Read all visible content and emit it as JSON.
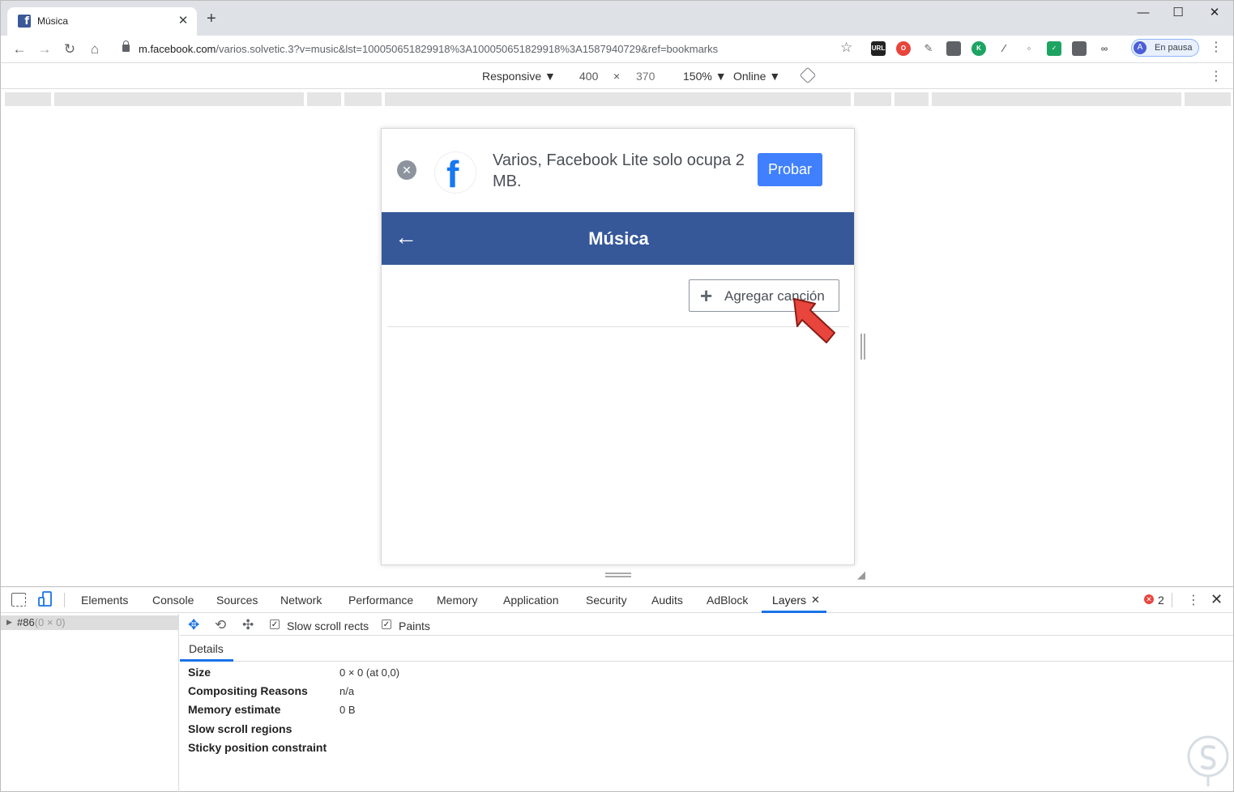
{
  "browser": {
    "tab_title": "Música",
    "tab_favicon": "facebook-f",
    "url_host": "m.facebook.com",
    "url_path": "/varios.solvetic.3?v=music&lst=100050651829918%3A100050651829918%3A1587940729&ref=bookmarks",
    "profile_initial": "A",
    "profile_label": "En pausa"
  },
  "device_toolbar": {
    "device": "Responsive",
    "width": "400",
    "times": "×",
    "height": "370",
    "zoom": "150%",
    "network": "Online"
  },
  "page": {
    "banner_text": "Varios, Facebook Lite solo ocupa 2 MB.",
    "banner_button": "Probar",
    "header_title": "Música",
    "add_button": "Agregar canción"
  },
  "devtools": {
    "tabs": [
      "Elements",
      "Console",
      "Sources",
      "Network",
      "Performance",
      "Memory",
      "Application",
      "Security",
      "Audits",
      "AdBlock",
      "Layers"
    ],
    "active_tab": "Layers",
    "error_count": "2",
    "layer_node": "#86",
    "layer_node_dims": "(0 × 0)",
    "slow_scroll_rects": "Slow scroll rects",
    "paints": "Paints",
    "details_tab": "Details",
    "properties": [
      {
        "name": "Size",
        "value": "0 × 0 (at 0,0)"
      },
      {
        "name": "Compositing Reasons",
        "value": "n/a"
      },
      {
        "name": "Memory estimate",
        "value": "0 B"
      },
      {
        "name": "Slow scroll regions",
        "value": ""
      },
      {
        "name": "Sticky position constraint",
        "value": ""
      }
    ]
  },
  "colors": {
    "facebook_blue": "#365899",
    "probar_blue": "#4080ff",
    "active_tab_underline": "#1a73e8",
    "pointer_red": "#e8453c"
  }
}
